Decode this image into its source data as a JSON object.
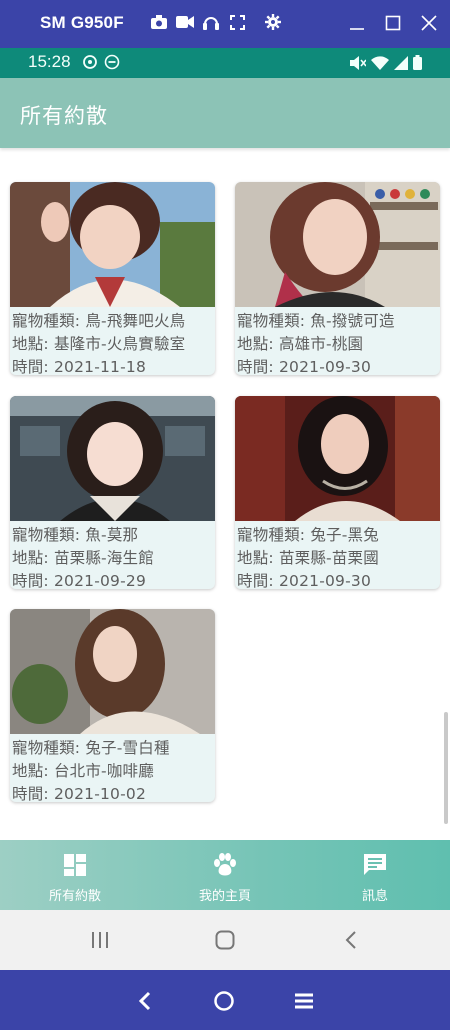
{
  "emulator": {
    "title": "SM G950F",
    "icons": [
      "camera-icon",
      "video-icon",
      "headset-icon",
      "fullscreen-icon",
      "settings-icon"
    ],
    "window_controls": [
      "minimize-icon",
      "maximize-icon",
      "close-icon"
    ]
  },
  "status_bar": {
    "time": "15:28",
    "icons_left": [
      "sync-icon",
      "dnd-icon"
    ],
    "icons_right": [
      "mute-icon",
      "wifi-icon",
      "signal-icon",
      "battery-icon"
    ],
    "color": "#0e8a7a"
  },
  "app_bar": {
    "title": "所有約散",
    "color": "#8cc3b6"
  },
  "cards": [
    {
      "pet": "寵物種類: 鳥-飛舞吧火鳥",
      "location": "地點: 基隆市-火鳥實驗室",
      "time": "時間: 2021-11-18"
    },
    {
      "pet": "寵物種類: 魚-撥號可造",
      "location": "地點: 高雄市-桃園",
      "time": "時間: 2021-09-30"
    },
    {
      "pet": "寵物種類: 魚-莫那",
      "location": "地點: 苗栗縣-海生館",
      "time": "時間: 2021-09-29"
    },
    {
      "pet": "寵物種類: 兔子-黑兔",
      "location": "地點: 苗栗縣-苗栗國",
      "time": "時間: 2021-09-30"
    },
    {
      "pet": "寵物種類: 兔子-雪白種",
      "location": "地點: 台北市-咖啡廳",
      "time": "時間: 2021-10-02"
    }
  ],
  "bottom_nav": {
    "items": [
      {
        "label": "所有約散",
        "icon": "dashboard-icon"
      },
      {
        "label": "我的主頁",
        "icon": "paw-icon"
      },
      {
        "label": "訊息",
        "icon": "message-icon"
      }
    ]
  },
  "system_nav": [
    "recents-button",
    "home-button",
    "back-button"
  ],
  "emulator_nav": [
    "back-button",
    "home-button",
    "menu-button"
  ]
}
